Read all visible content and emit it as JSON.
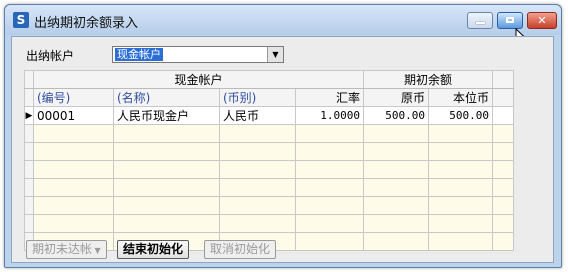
{
  "window": {
    "title": "出纳期初余额录入"
  },
  "account": {
    "label": "出纳帐户",
    "selected": "现金帐户"
  },
  "table": {
    "group_headers": {
      "cash_account": "现金帐户",
      "opening_balance": "期初余额"
    },
    "columns": [
      "(编号)",
      "(名称)",
      "(币别)",
      "汇率",
      "原币",
      "本位币"
    ],
    "rows": [
      {
        "code": "00001",
        "name": "人民币现金户",
        "currency": "人民币",
        "rate": "1.0000",
        "orig": "500.00",
        "base": "500.00"
      }
    ]
  },
  "buttons": {
    "unreconciled": "期初未达帐",
    "finish_init": "结束初始化",
    "cancel_init": "取消初始化"
  }
}
